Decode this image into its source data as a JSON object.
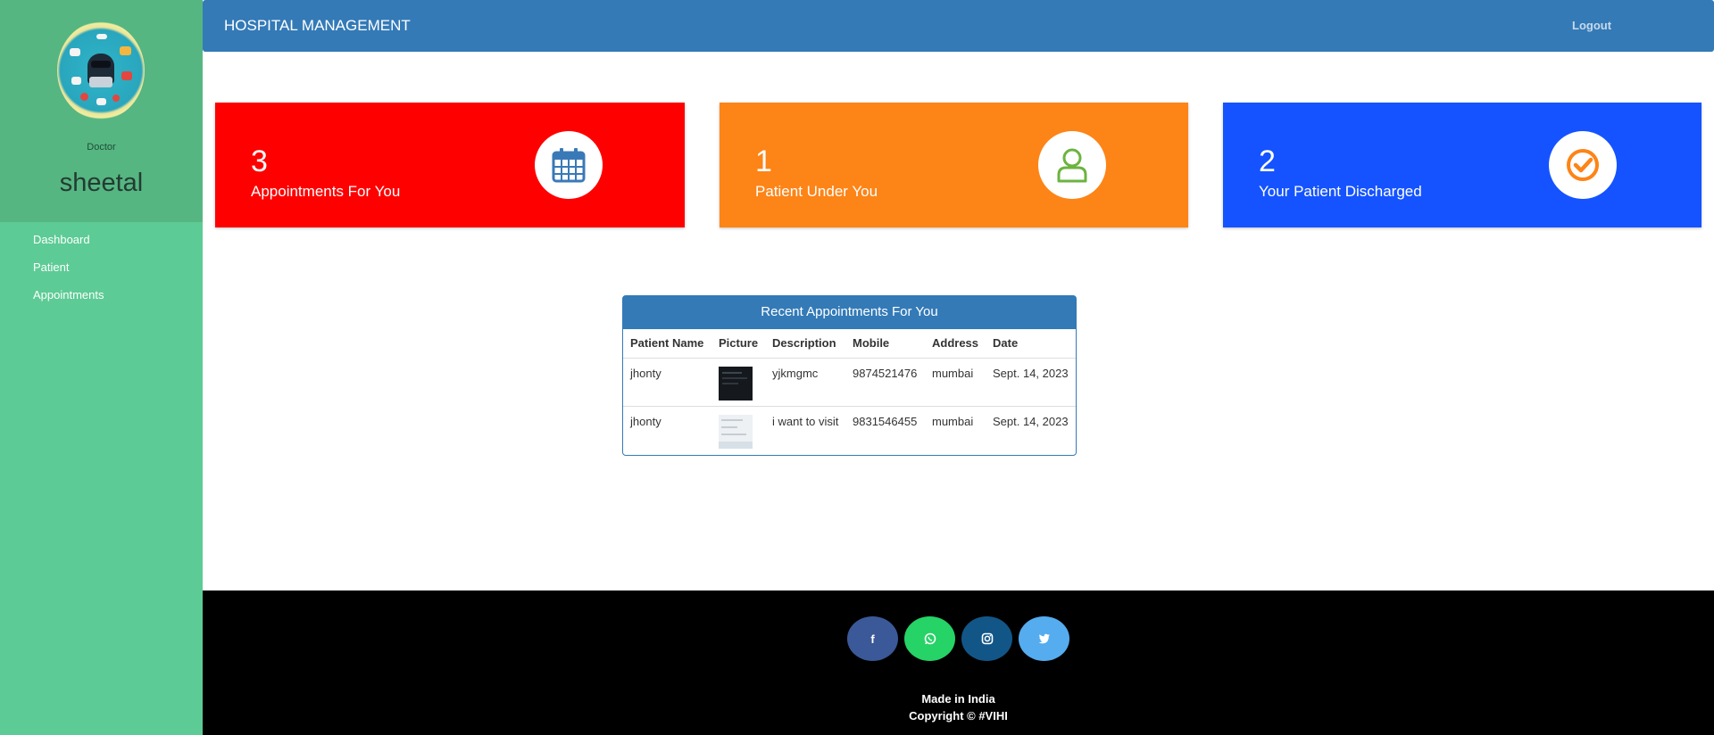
{
  "colors": {
    "sidebar": "#5dcb95",
    "profile_panel": "#55b682",
    "topbar": "#337ab7",
    "card_appointments": "#ff0000",
    "card_patients": "#fd8417",
    "card_discharged": "#1453ff",
    "footer": "#000000",
    "facebook": "#3b5998",
    "whatsapp": "#25d366",
    "instagram": "#125688",
    "twitter": "#55acee"
  },
  "sidebar": {
    "avatar_icon": "hacker-illustration-avatar",
    "role": "Doctor",
    "username": "sheetal",
    "items": [
      {
        "label": "Dashboard"
      },
      {
        "label": "Patient"
      },
      {
        "label": "Appointments"
      }
    ]
  },
  "header": {
    "title": "HOSPITAL MANAGEMENT",
    "logout": "Logout"
  },
  "cards": [
    {
      "value": "3",
      "label": "Appointments For You",
      "icon": "calendar-icon"
    },
    {
      "value": "1",
      "label": "Patient Under You",
      "icon": "user-icon"
    },
    {
      "value": "2",
      "label": "Your Patient Discharged",
      "icon": "check-circle-icon"
    }
  ],
  "appointments": {
    "title": "Recent Appointments For You",
    "columns": [
      "Patient Name",
      "Picture",
      "Description",
      "Mobile",
      "Address",
      "Date"
    ],
    "rows": [
      {
        "patient_name": "jhonty",
        "picture": "dark-screenshot-thumbnail",
        "description": "yjkmgmc",
        "mobile": "9874521476",
        "address": "mumbai",
        "date": "Sept. 14, 2023"
      },
      {
        "patient_name": "jhonty",
        "picture": "light-screenshot-thumbnail",
        "description": "i want to visit",
        "mobile": "9831546455",
        "address": "mumbai",
        "date": "Sept. 14, 2023"
      }
    ]
  },
  "footer": {
    "social": [
      "facebook-icon",
      "whatsapp-icon",
      "instagram-icon",
      "twitter-icon"
    ],
    "made_in": "Made in India",
    "copyright": "Copyright © #VIHI"
  }
}
